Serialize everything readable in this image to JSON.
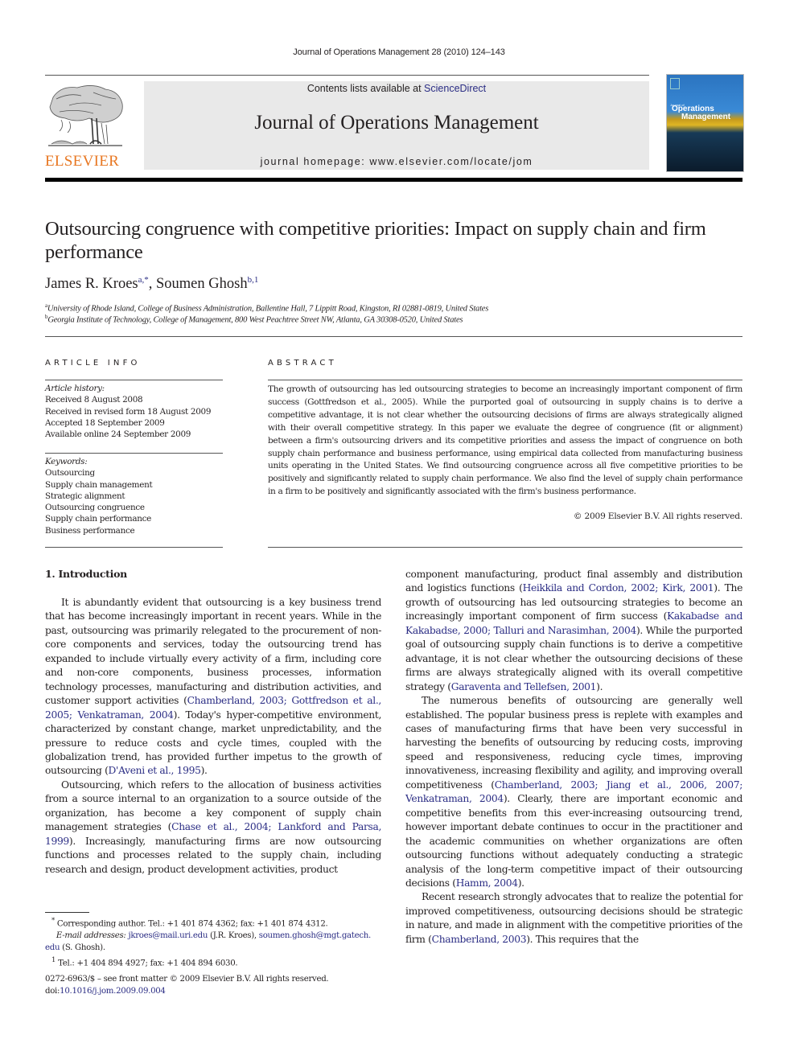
{
  "header": {
    "running_head": "Journal of Operations Management 28 (2010) 124–143",
    "publisher_wordmark": "ELSEVIER",
    "contents_prefix": "Contents lists available at ",
    "contents_link": "ScienceDirect",
    "journal_title": "Journal of Operations Management",
    "homepage": "journal homepage: www.elsevier.com/locate/jom",
    "cover": {
      "kicker": "Journal of",
      "line1": "Operations",
      "line2": "Management"
    },
    "logo_icon": "elsevier-tree-icon",
    "colors": {
      "elsevier_orange": "#e87722",
      "link_blue": "#2b2d84",
      "banner_gray": "#e9e9e9"
    }
  },
  "article": {
    "title": "Outsourcing congruence with competitive priorities: Impact on supply chain and firm performance",
    "authors": [
      {
        "name": "James R. Kroes",
        "marks": "a,*"
      },
      {
        "name": "Soumen Ghosh",
        "marks": "b,1"
      }
    ],
    "author_separator": ", ",
    "affiliations": [
      {
        "mark": "a",
        "text": "University of Rhode Island, College of Business Administration, Ballentine Hall, 7 Lippitt Road, Kingston, RI 02881-0819, United States"
      },
      {
        "mark": "b",
        "text": "Georgia Institute of Technology, College of Management, 800 West Peachtree Street NW, Atlanta, GA 30308-0520, United States"
      }
    ]
  },
  "article_info": {
    "label": "ARTICLE INFO",
    "history_label": "Article history:",
    "history": [
      "Received 8 August 2008",
      "Received in revised form 18 August 2009",
      "Accepted 18 September 2009",
      "Available online 24 September 2009"
    ],
    "keywords_label": "Keywords:",
    "keywords": [
      "Outsourcing",
      "Supply chain management",
      "Strategic alignment",
      "Outsourcing congruence",
      "Supply chain performance",
      "Business performance"
    ]
  },
  "abstract": {
    "label": "ABSTRACT",
    "text_before_cite": "The growth of outsourcing has led outsourcing strategies to become an increasingly important component of firm success (",
    "cite": "Gottfredson et al., 2005",
    "text_after_cite": "). While the purported goal of outsourcing in supply chains is to derive a competitive advantage, it is not clear whether the outsourcing decisions of firms are always strategically aligned with their overall competitive strategy. In this paper we evaluate the degree of congruence (fit or alignment) between a firm's outsourcing drivers and its competitive priorities and assess the impact of congruence on both supply chain performance and business performance, using empirical data collected from manufacturing business units operating in the United States. We find outsourcing congruence across all five competitive priorities to be positively and significantly related to supply chain performance. We also find the level of supply chain performance in a firm to be positively and significantly associated with the firm's business performance.",
    "copyright": "© 2009 Elsevier B.V. All rights reserved."
  },
  "body": {
    "section_heading": "1.  Introduction",
    "left_col": {
      "p1": [
        {
          "t": "It is abundantly evident that outsourcing is a key business trend that has become increasingly important in recent years. While in the past, outsourcing was primarily relegated to the procurement of non-core components and services, today the outsourcing trend has expanded to include virtually every activity of a firm, including core and non-core components, business processes, information technology processes, manufacturing and distribution activities, and customer support activities ("
        },
        {
          "t": "Chamberland, 2003; Gottfredson et al., 2005; Venkatraman, 2004",
          "link": true
        },
        {
          "t": "). Today's hyper-competitive environment, characterized by constant change, market unpredictability, and the pressure to reduce costs and cycle times, coupled with the globalization trend, has provided further impetus to the growth of outsourcing ("
        },
        {
          "t": "D'Aveni et al., 1995",
          "link": true
        },
        {
          "t": ")."
        }
      ],
      "p2": [
        {
          "t": "Outsourcing, which refers to the allocation of business activities from a source internal to an organization to a source outside of the organization, has become a key component of supply chain management strategies ("
        },
        {
          "t": "Chase et al., 2004; Lankford and Parsa, 1999",
          "link": true
        },
        {
          "t": "). Increasingly, manufacturing firms are now outsourcing functions and processes related to the supply chain, including research and design, product development activities, product"
        }
      ]
    },
    "right_col": {
      "p1": [
        {
          "t": "component manufacturing, product final assembly and distribution and logistics functions ("
        },
        {
          "t": "Heikkila and Cordon, 2002; Kirk, 2001",
          "link": true
        },
        {
          "t": "). The growth of outsourcing has led outsourcing strategies to become an increasingly important component of firm success ("
        },
        {
          "t": "Kakabadse and Kakabadse, 2000; Talluri and Narasimhan, 2004",
          "link": true
        },
        {
          "t": "). While the purported goal of outsourcing supply chain functions is to derive a competitive advantage, it is not clear whether the outsourcing decisions of these firms are always strategically aligned with its overall competitive strategy ("
        },
        {
          "t": "Garaventa and Tellefsen, 2001",
          "link": true
        },
        {
          "t": ")."
        }
      ],
      "p2": [
        {
          "t": "The numerous benefits of outsourcing are generally well established. The popular business press is replete with examples and cases of manufacturing firms that have been very successful in harvesting the benefits of outsourcing by reducing costs, improving speed and responsiveness, reducing cycle times, improving innovativeness, increasing flexibility and agility, and improving overall competitiveness ("
        },
        {
          "t": "Chamberland, 2003; Jiang et al., 2006, 2007; Venkatraman, 2004",
          "link": true
        },
        {
          "t": "). Clearly, there are important economic and competitive benefits from this ever-increasing outsourcing trend, however important debate continues to occur in the practitioner and the academic communities on whether organizations are often outsourcing functions without adequately conducting a strategic analysis of the long-term competitive impact of their outsourcing decisions ("
        },
        {
          "t": "Hamm, 2004",
          "link": true
        },
        {
          "t": ")."
        }
      ],
      "p3": [
        {
          "t": "Recent research strongly advocates that to realize the potential for improved competitiveness, outsourcing decisions should be strategic in nature, and made in alignment with the competitive priorities of the firm ("
        },
        {
          "t": "Chamberland, 2003",
          "link": true
        },
        {
          "t": "). This requires that the"
        }
      ]
    }
  },
  "footnotes": {
    "corresponding_mark": "*",
    "corresponding": "Corresponding author. Tel.: +1 401 874 4362; fax: +1 401 874 4312.",
    "email_label": "E-mail addresses:",
    "email1": "jkroes@mail.uri.edu",
    "email1_owner": " (J.R. Kroes), ",
    "email2_part1": "soumen.ghosh@mgt.gatech.",
    "email2_part2": "edu",
    "email2_owner": " (S. Ghosh).",
    "fn1_mark": "1",
    "fn1": "Tel.: +1 404 894 4927; fax: +1 404 894 6030."
  },
  "front_matter": {
    "issn_line": "0272-6963/$ – see front matter © 2009 Elsevier B.V. All rights reserved.",
    "doi_prefix": "doi:",
    "doi": "10.1016/j.jom.2009.09.004"
  }
}
